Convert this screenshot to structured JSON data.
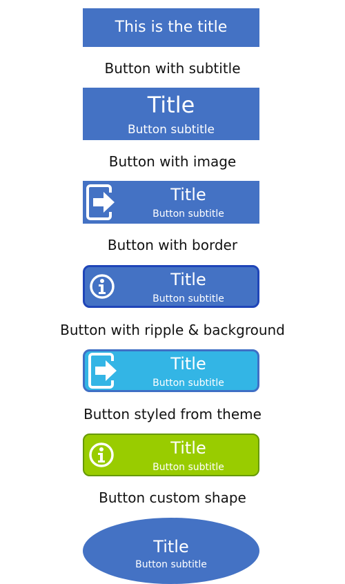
{
  "buttons": [
    {
      "title": "This is the title"
    },
    {
      "label": "Button with subtitle",
      "title": "Title",
      "subtitle": "Button subtitle"
    },
    {
      "label": "Button with image",
      "title": "Title",
      "subtitle": "Button subtitle",
      "icon": "exit-icon"
    },
    {
      "label": "Button with border",
      "title": "Title",
      "subtitle": "Button subtitle",
      "icon": "info-icon"
    },
    {
      "label": "Button with ripple & background",
      "title": "Title",
      "subtitle": "Button subtitle",
      "icon": "exit-icon"
    },
    {
      "label": "Button styled from theme",
      "title": "Title",
      "subtitle": "Button subtitle",
      "icon": "info-icon"
    },
    {
      "label": "Button custom shape",
      "title": "Title",
      "subtitle": "Button subtitle"
    }
  ],
  "colors": {
    "primary": "#4472c4",
    "border": "#1f45b8",
    "ripple_bg": "#33b5e5",
    "theme_bg": "#99cc00",
    "theme_border": "#669900"
  }
}
